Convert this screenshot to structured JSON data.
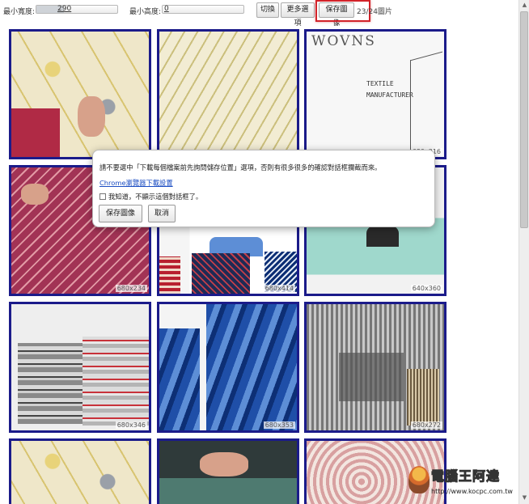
{
  "toolbar": {
    "min_width_label": "最小寬度:",
    "min_width_value": "290",
    "min_width_fraction": 0.34,
    "min_height_label": "最小高度:",
    "min_height_value": "0",
    "min_height_fraction": 0.0,
    "toggle_label": "切換",
    "more_options_label": "更多選項",
    "save_images_label": "保存圖像",
    "image_count": "23/24圖片"
  },
  "tiles": [
    {
      "dim": ""
    },
    {
      "dim": ""
    },
    {
      "dim": "680x316"
    },
    {
      "dim": "680x234"
    },
    {
      "dim": "680x414"
    },
    {
      "dim": "640x360"
    },
    {
      "dim": "680x346"
    },
    {
      "dim": "680x353"
    },
    {
      "dim": "680x272"
    },
    {
      "dim": ""
    },
    {
      "dim": ""
    },
    {
      "dim": ""
    }
  ],
  "wovns": {
    "logo": "WOVNS",
    "line1": "TEXTILE",
    "line2": "MANUFACTURER"
  },
  "dialog": {
    "message": "請不要選中「下載每個檔案前先詢問儲存位置」選項，否則有很多很多的確認對話框攔截而來。",
    "link": "Chrome瀏覽器下載設置",
    "checkbox_label": "我知道，不顯示這個對話框了。",
    "save_button": "保存圖像",
    "cancel_button": "取消"
  },
  "watermark": {
    "title": "電腦王阿達",
    "url": "http://www.kocpc.com.tw"
  },
  "colors": {
    "tile_border": "#1b1b8a",
    "highlight": "#d2232a",
    "link": "#1a4cc2"
  }
}
